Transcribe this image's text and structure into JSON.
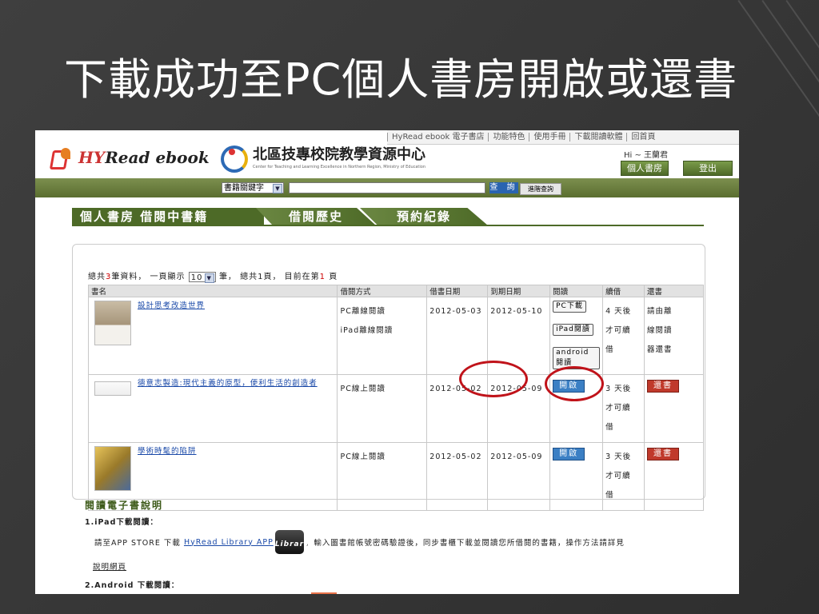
{
  "slide": {
    "title": "下載成功至PC個人書房開啟或還書"
  },
  "site": {
    "top_links": [
      "HyRead ebook 電子書店",
      "功能特色",
      "使用手冊",
      "下載閱讀軟體",
      "回首頁"
    ],
    "logo_text_hy": "HY",
    "logo_text_read": "Read ebook",
    "center_name": "北區技專校院教學資源中心",
    "center_sub": "Center for Teaching and Learning Excellence in Northern Region, Ministry of Education",
    "greeting": "Hi ~ 王蘭君",
    "personal_button": "個人書房",
    "logout_button": "登出"
  },
  "search": {
    "category": "書籍關鍵字",
    "query_value": "",
    "submit_label": "查 詢",
    "advanced_label": "進階查詢"
  },
  "tabs": [
    {
      "label": "個人書房  借閱中書籍"
    },
    {
      "label": "借閱歷史"
    },
    {
      "label": "預約紀錄"
    }
  ],
  "summary": {
    "prefix": "總共",
    "total": "3",
    "mid": "筆資料， 一頁顯示",
    "per_page": "10",
    "suffix": "筆， 總共1頁， 目前在第",
    "current_page": "1",
    "end": "頁"
  },
  "table": {
    "headers": [
      "書名",
      "借閱方式",
      "借書日期",
      "到期日期",
      "閱讀",
      "續借",
      "還書"
    ],
    "rows": [
      {
        "title": "設計思考改造世界",
        "method_1": "PC離線閱讀",
        "method_2": "iPad離線閱讀",
        "borrow_date": "2012-05-03",
        "due_date": "2012-05-10",
        "read_1": "PC下載",
        "read_2": "iPad閱讀",
        "read_3": "android閱讀",
        "renew_1": "4 天後",
        "renew_2": "才可續",
        "renew_3": "借",
        "return_1": "請由離",
        "return_2": "線閱讀",
        "return_3": "器還書"
      },
      {
        "title": "德意志製造:現代主義的原型，便利生活的創造者",
        "method_1": "PC線上閱讀",
        "borrow_date": "2012-05-02",
        "due_date": "2012-05-09",
        "read_1": "開啟",
        "renew_1": "3 天後",
        "renew_2": "才可續",
        "renew_3": "借",
        "return_1": "還書"
      },
      {
        "title": "學術時髦的陷阱",
        "method_1": "PC線上閱讀",
        "borrow_date": "2012-05-02",
        "due_date": "2012-05-09",
        "read_1": "開啟",
        "renew_1": "3 天後",
        "renew_2": "才可續",
        "renew_3": "借",
        "return_1": "還書"
      }
    ]
  },
  "instructions": {
    "title": "閱讀電子書說明",
    "ipad_heading": "1.iPad下載閱讀：",
    "ipad_text_1": "請至APP STORE 下載",
    "ipad_link": "HyRead Library APP",
    "ipad_app_icon": "Library",
    "ipad_text_2": "，輸入圖書館帳號密碼驗證後，同步書櫃下載並閱讀您所借閱的書籍，操作方法請詳見",
    "ipad_more_link": "說明網頁",
    "android_heading": "2.Android 下載閱讀："
  },
  "colors": {
    "accent_green": "#4d6a27",
    "highlight_red": "#c0131a",
    "link_blue": "#1a49a8"
  }
}
